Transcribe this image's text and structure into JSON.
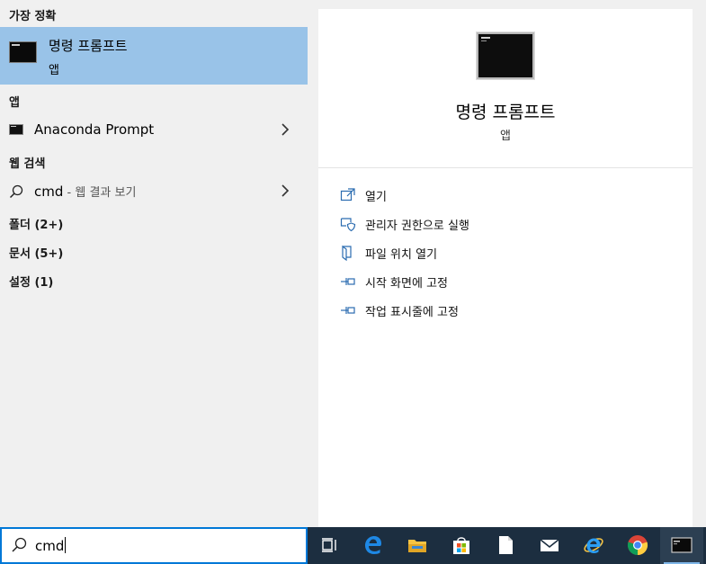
{
  "sections": {
    "best_match": "가장 정확",
    "apps": "앱",
    "web_search": "웹 검색",
    "folders": "폴더 (2+)",
    "documents": "문서 (5+)",
    "settings": "설정 (1)"
  },
  "best_match_item": {
    "title": "명령 프롬프트",
    "subtitle": "앱"
  },
  "apps_item": {
    "label": "Anaconda Prompt"
  },
  "web_item": {
    "query": "cmd",
    "suffix": " - 웹 결과 보기"
  },
  "preview": {
    "title": "명령 프롬프트",
    "subtitle": "앱"
  },
  "actions": [
    {
      "label": "열기",
      "icon": "open-icon"
    },
    {
      "label": "관리자 권한으로 실행",
      "icon": "shield-icon"
    },
    {
      "label": "파일 위치 열기",
      "icon": "file-location-icon"
    },
    {
      "label": "시작 화면에 고정",
      "icon": "pin-icon"
    },
    {
      "label": "작업 표시줄에 고정",
      "icon": "pin-icon"
    }
  ],
  "search": {
    "value": "cmd"
  },
  "taskbar": {
    "icons": [
      "task-view-icon",
      "edge-icon",
      "file-explorer-icon",
      "store-icon",
      "file-icon",
      "mail-icon",
      "internet-explorer-icon",
      "chrome-icon",
      "command-prompt-icon"
    ]
  },
  "colors": {
    "highlight": "#99c3e8",
    "accent": "#0078d7",
    "taskbar": "#1c2e40",
    "link_icon": "#2b6cb0"
  }
}
